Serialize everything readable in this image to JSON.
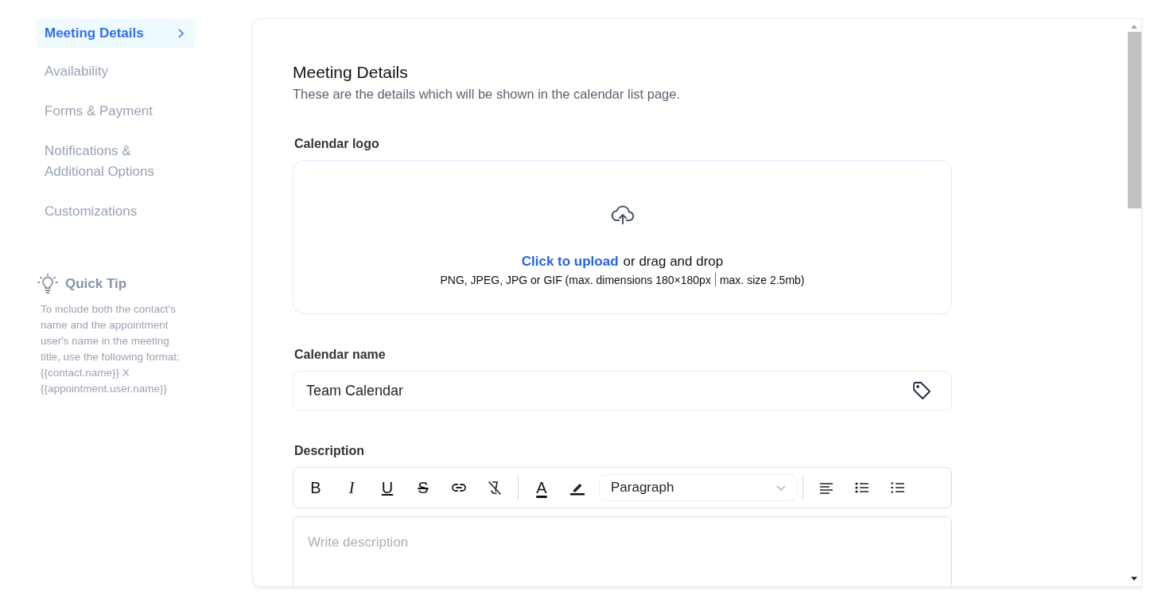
{
  "sidebar": {
    "items": [
      {
        "label": "Meeting Details",
        "selected": true
      },
      {
        "label": "Availability",
        "selected": false
      },
      {
        "label": "Forms & Payment",
        "selected": false
      },
      {
        "label": "Notifications & Additional Options",
        "selected": false
      },
      {
        "label": "Customizations",
        "selected": false
      }
    ]
  },
  "quick_tip": {
    "title": "Quick Tip",
    "text": "To include both the contact's name and the appointment user's name in the meeting title, use the following format: {{contact.name}} X {{appointment.user.name}}"
  },
  "section": {
    "title": "Meeting Details",
    "subtitle": "These are the details which will be shown in the calendar list page."
  },
  "calendar_logo": {
    "label": "Calendar logo",
    "link": "Click to upload",
    "text": "or drag and drop",
    "hints": [
      "PNG, JPEG, JPG or GIF (max. dimensions 180×180px",
      "max. size 2.5mb)"
    ]
  },
  "calendar_name": {
    "label": "Calendar name",
    "value": "Team Calendar"
  },
  "description": {
    "label": "Description",
    "placeholder": "Write description",
    "toolbar": [
      {
        "kind": "bold",
        "glyph": "B"
      },
      {
        "kind": "italic",
        "glyph": "I"
      },
      {
        "kind": "underline",
        "glyph": "U"
      },
      {
        "kind": "strike",
        "glyph": "S"
      },
      {
        "kind": "link"
      },
      {
        "kind": "clear"
      },
      {
        "kind": "divider"
      },
      {
        "kind": "color",
        "glyph": "A"
      },
      {
        "kind": "highlight"
      },
      {
        "kind": "select",
        "value": "Paragraph"
      },
      {
        "kind": "divider"
      },
      {
        "kind": "align"
      },
      {
        "kind": "bullets"
      },
      {
        "kind": "numbers"
      }
    ]
  }
}
